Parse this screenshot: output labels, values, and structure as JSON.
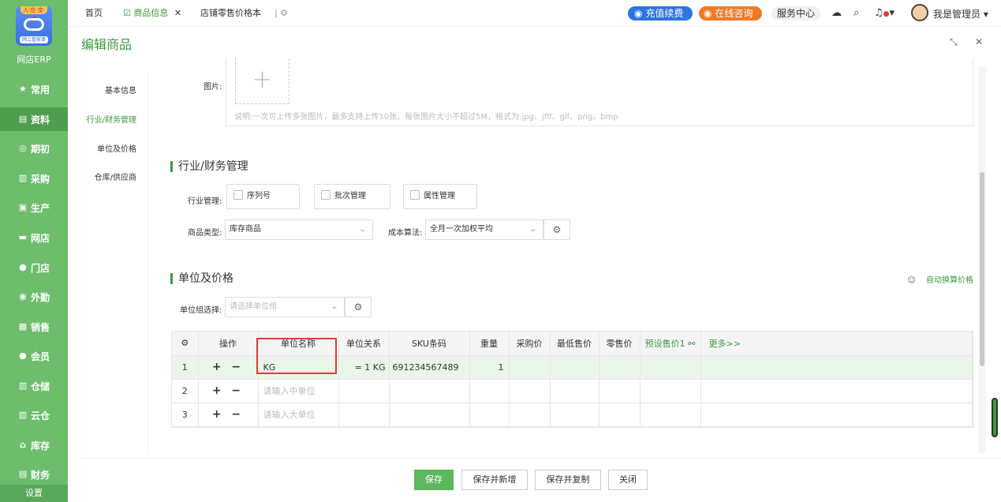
{
  "sidebar": {
    "logo_top": "人·在·宝·卡",
    "logo_badge": "网上管家婆",
    "logo_text": "网店ERP",
    "items": [
      {
        "icon": "★",
        "label": "常用"
      },
      {
        "icon": "▤",
        "label": "资料"
      },
      {
        "icon": "◎",
        "label": "期初"
      },
      {
        "icon": "▥",
        "label": "采购"
      },
      {
        "icon": "▣",
        "label": "生产"
      },
      {
        "icon": "▬",
        "label": "网店"
      },
      {
        "icon": "●",
        "label": "门店"
      },
      {
        "icon": "◉",
        "label": "外勤"
      },
      {
        "icon": "▦",
        "label": "销售"
      },
      {
        "icon": "●",
        "label": "会员"
      },
      {
        "icon": "▥",
        "label": "仓储"
      },
      {
        "icon": "▥",
        "label": "云仓"
      },
      {
        "icon": "⌂",
        "label": "库存"
      },
      {
        "icon": "▤",
        "label": "财务"
      }
    ],
    "settings": "设置"
  },
  "topbar": {
    "tabs": [
      "首页",
      "商品信息",
      "店铺零售价格本"
    ],
    "recharge": "充值续费",
    "consult": "在线咨询",
    "service": "服务中心",
    "admin": "我是管理员"
  },
  "header": {
    "title": "编辑商品"
  },
  "leftnav": [
    "基本信息",
    "行业/财务管理",
    "单位及价格",
    "仓库/供应商"
  ],
  "image_section": {
    "label": "图片:",
    "note": "说明:一次可上传多张图片，最多支持上传10张。每张图片大小不超过5M，格式为:jpg、jfif、gif、png、bmp"
  },
  "industry": {
    "title": "行业/财务管理",
    "mgmt_label": "行业管理:",
    "checks": [
      "序列号",
      "批次管理",
      "属性管理"
    ],
    "type_label": "商品类型:",
    "type_value": "库存商品",
    "cost_label": "成本算法:",
    "cost_value": "全月一次加权平均"
  },
  "units": {
    "title": "单位及价格",
    "auto_link": "自动换算价格",
    "group_label": "单位组选择:",
    "group_placeholder": "请选择单位组",
    "columns": [
      "操作",
      "单位名称",
      "单位关系",
      "SKU条码",
      "重量",
      "采购价",
      "最低售价",
      "零售价",
      "预设售价1",
      "更多>>"
    ],
    "rows": [
      {
        "num": "1",
        "ops": "+ −",
        "name": "KG",
        "rel": "= 1 KG",
        "sku": "691234567489",
        "weight": "1"
      },
      {
        "num": "2",
        "ops": "+ −",
        "name": "请输入中单位",
        "rel": "",
        "sku": "",
        "weight": ""
      },
      {
        "num": "3",
        "ops": "+ −",
        "name": "请输入大单位",
        "rel": "",
        "sku": "",
        "weight": ""
      }
    ]
  },
  "footer": {
    "save": "保存",
    "save_new": "保存并新增",
    "save_copy": "保存并复制",
    "close": "关闭"
  }
}
